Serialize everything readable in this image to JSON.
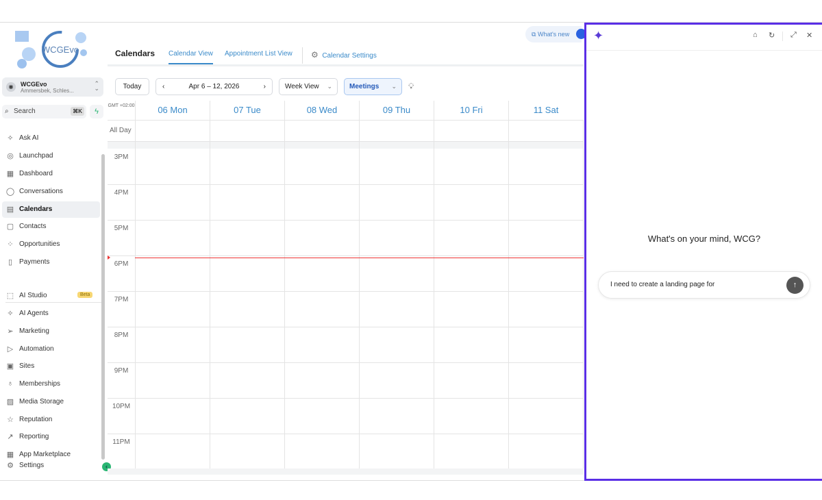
{
  "account": {
    "name": "WCGEvo",
    "location": "Ammersbek, Schles..."
  },
  "logo_text": "WCGEvo",
  "search": {
    "label": "Search",
    "shortcut": "⌘K"
  },
  "nav_main": [
    {
      "label": "Ask AI",
      "icon": "sparkle-icon",
      "glyph": "✧"
    },
    {
      "label": "Launchpad",
      "icon": "rocket-icon",
      "glyph": "◎"
    },
    {
      "label": "Dashboard",
      "icon": "grid-icon",
      "glyph": "▦"
    },
    {
      "label": "Conversations",
      "icon": "chat-icon",
      "glyph": "◯"
    },
    {
      "label": "Calendars",
      "icon": "calendar-icon",
      "glyph": "▤",
      "active": true
    },
    {
      "label": "Contacts",
      "icon": "contacts-icon",
      "glyph": "▢"
    },
    {
      "label": "Opportunities",
      "icon": "opportunities-icon",
      "glyph": "⁘"
    },
    {
      "label": "Payments",
      "icon": "payments-icon",
      "glyph": "▯"
    }
  ],
  "nav_secondary": [
    {
      "label": "AI Studio",
      "icon": "ai-studio-icon",
      "glyph": "⬚",
      "badge": "Beta"
    },
    {
      "label": "AI Agents",
      "icon": "ai-agents-icon",
      "glyph": "✧"
    },
    {
      "label": "Marketing",
      "icon": "send-icon",
      "glyph": "➢"
    },
    {
      "label": "Automation",
      "icon": "automation-icon",
      "glyph": "▷"
    },
    {
      "label": "Sites",
      "icon": "sites-icon",
      "glyph": "▣"
    },
    {
      "label": "Memberships",
      "icon": "membership-icon",
      "glyph": "♁"
    },
    {
      "label": "Media Storage",
      "icon": "image-icon",
      "glyph": "▨"
    },
    {
      "label": "Reputation",
      "icon": "star-icon",
      "glyph": "☆"
    },
    {
      "label": "Reporting",
      "icon": "trend-icon",
      "glyph": "↗"
    },
    {
      "label": "App Marketplace",
      "icon": "apps-icon",
      "glyph": "▦"
    },
    {
      "label": "Settings",
      "icon": "gear-icon",
      "glyph": "⚙"
    }
  ],
  "header": {
    "title": "Calendars",
    "tabs": [
      "Calendar View",
      "Appointment List View",
      "Calendar Settings"
    ],
    "whats_new": "What's new"
  },
  "toolbar": {
    "today": "Today",
    "date_range": "Apr 6 – 12, 2026",
    "view": "Week View",
    "calendar": "Meetings"
  },
  "calendar": {
    "timezone": "GMT +02:00",
    "all_day": "All Day",
    "days": [
      "06 Mon",
      "07 Tue",
      "08 Wed",
      "09 Thu",
      "10 Fri",
      "11 Sat"
    ],
    "hours": [
      "3PM",
      "4PM",
      "5PM",
      "6PM",
      "7PM",
      "8PM",
      "9PM",
      "10PM",
      "11PM"
    ]
  },
  "ai_panel": {
    "prompt": "What's on your mind, WCG?",
    "input_value": "I need to create a landing page for",
    "accent": "#5a2ee6"
  }
}
